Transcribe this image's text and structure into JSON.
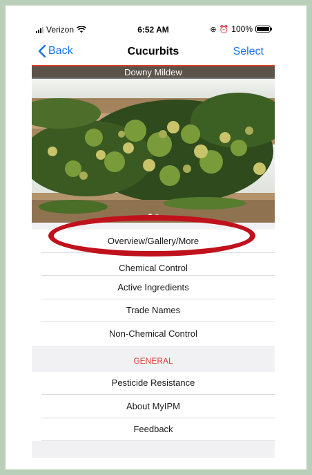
{
  "status_bar": {
    "carrier": "Verizon",
    "time": "6:52 AM",
    "battery_label": "100%"
  },
  "nav": {
    "back_label": "Back",
    "title": "Cucurbits",
    "select_label": "Select"
  },
  "hero": {
    "caption": "Downy Mildew",
    "page_count": 2,
    "active_page": 1
  },
  "menu": {
    "items": [
      {
        "label": "Overview/Gallery/More"
      },
      {
        "label": "Chemical Control"
      },
      {
        "label": "Active Ingredients"
      },
      {
        "label": "Trade Names"
      },
      {
        "label": "Non-Chemical Control"
      }
    ],
    "section_header": "GENERAL",
    "general_items": [
      {
        "label": "Pesticide Resistance"
      },
      {
        "label": "About MyIPM"
      },
      {
        "label": "Feedback"
      }
    ]
  },
  "colors": {
    "accent_blue": "#1a73e8",
    "section_red": "#e0423a",
    "highlight_ring": "#c0121d",
    "frame_green": "#b9cfb9"
  }
}
